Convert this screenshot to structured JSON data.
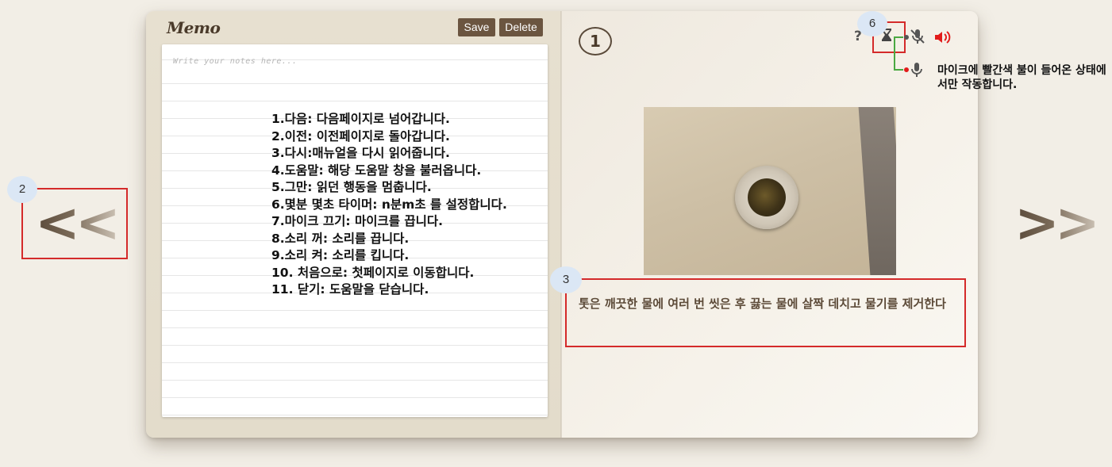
{
  "memo": {
    "title": "Memo",
    "save_label": "Save",
    "delete_label": "Delete",
    "placeholder": "Write your notes here..."
  },
  "help_items": [
    "1.다음: 다음페이지로 넘어갑니다.",
    "2.이전: 이전페이지로 돌아갑니다.",
    "3.다시:매뉴얼을 다시 읽어줍니다.",
    "4.도움말: 해당 도움말 창을 불러옵니다.",
    "5.그만: 읽던 행동을 멈춥니다.",
    "6.몇분 몇초 타이머: n분m초 를 설정합니다.",
    "7.마이크 끄기: 마이크를 끕니다.",
    "8.소리 꺼: 소리를 끕니다.",
    "9.소리 켜: 소리를 킵니다.",
    "10. 처음으로: 첫페이지로 이동합니다.",
    "11. 닫기: 도움말을 닫습니다."
  ],
  "page": {
    "number": "1",
    "caption": "톳은 깨끗한 물에 여러 번 씻은 후 끓는 물에 살짝 데치고 물기를 제거한다",
    "toolbar_help": "?"
  },
  "annotations": {
    "mic_note": "마이크에 빨간색 불이 들어온 상태에서만 작동합니다.",
    "badge_2": "2",
    "badge_3": "3",
    "badge_6": "6"
  },
  "navigation": {
    "prev_label": "<<",
    "next_label": ">>"
  },
  "icons": {
    "hourglass": "hourglass-icon",
    "mic_off": "mic-off-icon",
    "speaker": "speaker-icon",
    "mic_on": "mic-on-icon"
  },
  "colors": {
    "accent_brown": "#6b5540",
    "annotation_red": "#d42a2a",
    "speaker_red": "#e21b1b",
    "connector_green": "#4aa842"
  }
}
